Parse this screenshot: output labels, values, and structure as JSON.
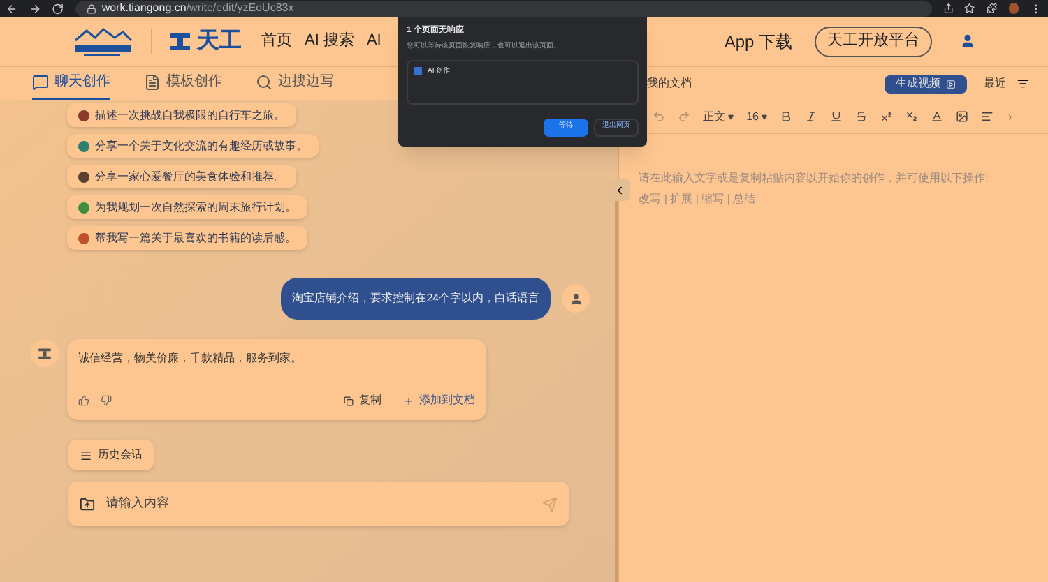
{
  "browser": {
    "url_host": "work.tiangong.cn",
    "url_path": "/write/edit/yzEoUc83x"
  },
  "header": {
    "brand": "天工",
    "nav": [
      "首页",
      "AI 搜索",
      "AI"
    ],
    "app_download": "App 下载",
    "open_platform": "天工开放平台"
  },
  "tabs": [
    {
      "label": "聊天创作",
      "selected": true,
      "kind": "chat"
    },
    {
      "label": "模板创作",
      "selected": false,
      "kind": "template"
    },
    {
      "label": "边搜边写",
      "selected": false,
      "kind": "search"
    }
  ],
  "suggestions": [
    {
      "text": "描述一次挑战自我极限的自行车之旅。",
      "color": "#8b3a2a"
    },
    {
      "text": "分享一个关于文化交流的有趣经历或故事。",
      "color": "#2f7f6f"
    },
    {
      "text": "分享一家心爱餐厅的美食体验和推荐。",
      "color": "#5a4030"
    },
    {
      "text": "为我规划一次自然探索的周末旅行计划。",
      "color": "#3f8f3f"
    },
    {
      "text": "帮我写一篇关于最喜欢的书籍的读后感。",
      "color": "#c0502a"
    }
  ],
  "user_message": "淘宝店铺介绍，要求控制在24个字以内，白话语言",
  "reply": {
    "text": "诚信经营，物美价廉，千款精品，服务到家。",
    "copy": "复制",
    "add_to_doc": "添加到文档"
  },
  "history_button": "历史会话",
  "input": {
    "placeholder": "请输入内容"
  },
  "document": {
    "title": "我的文档",
    "generate_video": "生成视频",
    "recent": "最近",
    "style": "正文",
    "font_size": "16",
    "placeholder": "请在此输入文字或是复制粘贴内容以开始你的创作，并可使用以下操作: 改写 | 扩展 | 缩写 | 总结"
  },
  "dialog": {
    "title": "1 个页面无响应",
    "message": "您可以等待该页面恢复响应，也可以退出该页面。",
    "page": "AI 创作",
    "wait": "等待",
    "exit": "退出网页"
  }
}
